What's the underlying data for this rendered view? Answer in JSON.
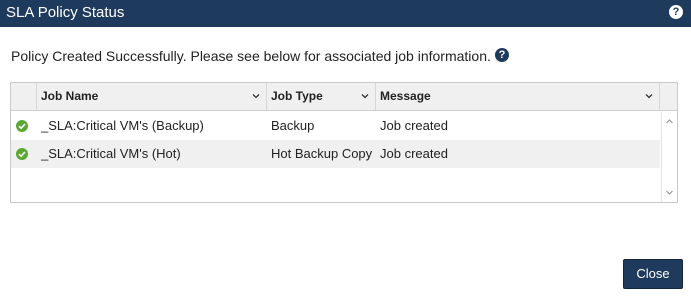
{
  "dialog": {
    "title": "SLA Policy Status",
    "help_glyph": "?",
    "message": "Policy Created Successfully. Please see below for associated job information.",
    "message_help_glyph": "?"
  },
  "grid": {
    "columns": [
      {
        "key": "status",
        "label": ""
      },
      {
        "key": "job_name",
        "label": "Job Name"
      },
      {
        "key": "job_type",
        "label": "Job Type"
      },
      {
        "key": "message",
        "label": "Message"
      }
    ],
    "rows": [
      {
        "status": "success",
        "job_name": "_SLA:Critical VM's (Backup)",
        "job_type": "Backup",
        "message": "Job created"
      },
      {
        "status": "success",
        "job_name": "_SLA:Critical VM's (Hot)",
        "job_type": "Hot Backup Copy",
        "message": "Job created"
      }
    ]
  },
  "buttons": {
    "close_label": "Close"
  },
  "colors": {
    "header_bar": "#1e3a5c",
    "success_icon": "#5aa832",
    "primary_button": "#1e3a5c"
  },
  "icons": {
    "sort": "chevron-down-icon",
    "status": "check-circle-icon",
    "help": "question-circle-icon"
  }
}
